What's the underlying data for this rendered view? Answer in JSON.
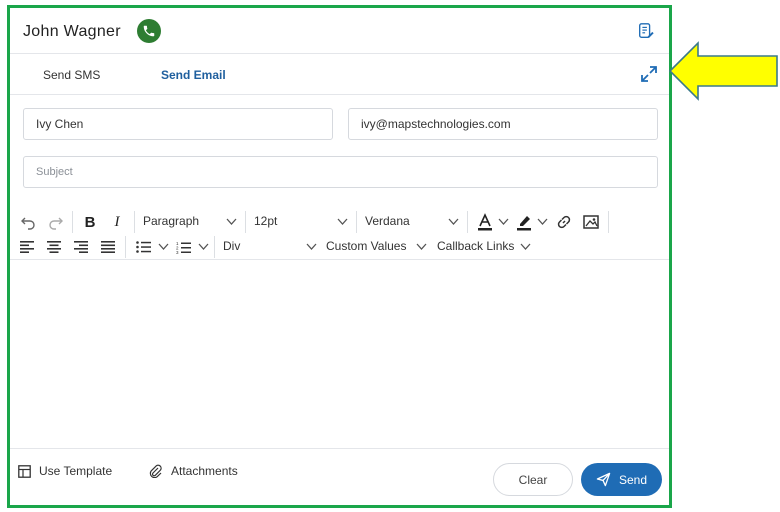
{
  "header": {
    "contact_name": "John Wagner"
  },
  "tabs": [
    {
      "label": "Send SMS",
      "active": false
    },
    {
      "label": "Send Email",
      "active": true
    }
  ],
  "form": {
    "name_value": "Ivy Chen",
    "email_value": "ivy@mapstechnologies.com",
    "subject_placeholder": "Subject"
  },
  "toolbar": {
    "block_format": "Paragraph",
    "font_size": "12pt",
    "font_family": "Verdana",
    "container": "Div",
    "custom_values": "Custom Values",
    "callback_links": "Callback Links"
  },
  "footer": {
    "use_template": "Use Template",
    "attachments": "Attachments",
    "clear": "Clear",
    "send": "Send"
  },
  "colors": {
    "frame_border": "#1aa64a",
    "accent": "#1f6cb5",
    "phone_badge": "#2e7d32",
    "callout_arrow": "#ffff00"
  }
}
